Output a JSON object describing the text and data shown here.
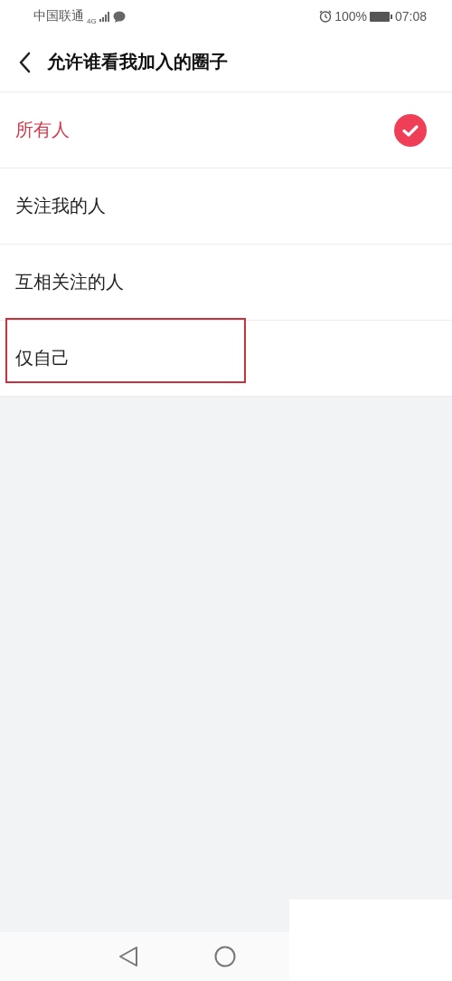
{
  "status_bar": {
    "carrier": "中国联通",
    "network": "4G",
    "battery": "100%",
    "time": "07:08"
  },
  "header": {
    "title": "允许谁看我加入的圈子"
  },
  "options": [
    {
      "label": "所有人",
      "selected": true,
      "highlighted": false
    },
    {
      "label": "关注我的人",
      "selected": false,
      "highlighted": false
    },
    {
      "label": "互相关注的人",
      "selected": false,
      "highlighted": false
    },
    {
      "label": "仅自己",
      "selected": false,
      "highlighted": true
    }
  ]
}
